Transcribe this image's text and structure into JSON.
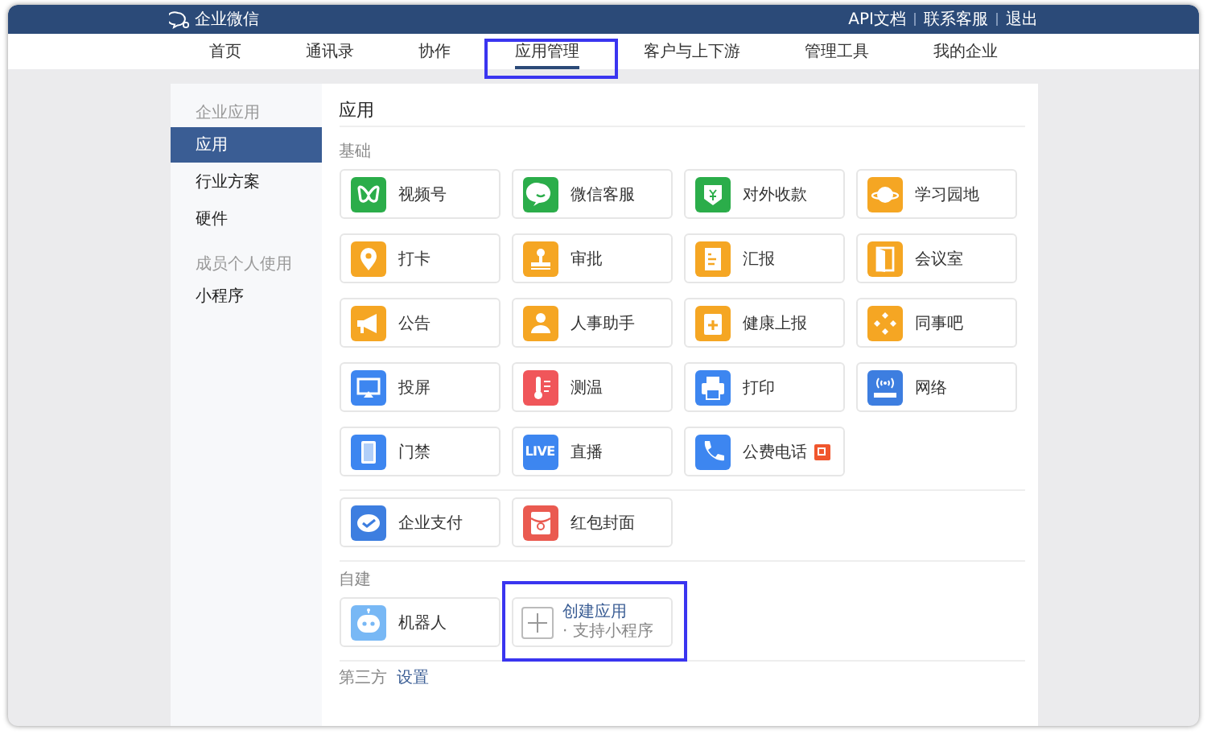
{
  "topbar": {
    "brand": "企业微信",
    "links": [
      "API文档",
      "联系客服",
      "退出"
    ]
  },
  "nav": [
    {
      "label": "首页",
      "selected": false,
      "highlighted": false
    },
    {
      "label": "通讯录",
      "selected": false,
      "highlighted": false
    },
    {
      "label": "协作",
      "selected": false,
      "highlighted": false
    },
    {
      "label": "应用管理",
      "selected": true,
      "highlighted": true
    },
    {
      "label": "客户与上下游",
      "selected": false,
      "highlighted": false
    },
    {
      "label": "管理工具",
      "selected": false,
      "highlighted": false
    },
    {
      "label": "我的企业",
      "selected": false,
      "highlighted": false
    }
  ],
  "sidebar": {
    "groups": [
      {
        "label": "企业应用",
        "items": [
          {
            "label": "应用",
            "selected": true
          },
          {
            "label": "行业方案",
            "selected": false
          },
          {
            "label": "硬件",
            "selected": false
          }
        ]
      },
      {
        "label": "成员个人使用",
        "items": [
          {
            "label": "小程序",
            "selected": false
          }
        ]
      }
    ]
  },
  "main": {
    "title": "应用",
    "sections": [
      {
        "label": "基础",
        "apps": [
          {
            "name": "视频号",
            "color": "#2bad4a"
          },
          {
            "name": "微信客服",
            "color": "#2bad4a"
          },
          {
            "name": "对外收款",
            "color": "#2bad4a"
          },
          {
            "name": "学习园地",
            "color": "#f5a623"
          },
          {
            "name": "打卡",
            "color": "#f5a623"
          },
          {
            "name": "审批",
            "color": "#f5a623"
          },
          {
            "name": "汇报",
            "color": "#f5a623"
          },
          {
            "name": "会议室",
            "color": "#f5a623"
          },
          {
            "name": "公告",
            "color": "#f5a623"
          },
          {
            "name": "人事助手",
            "color": "#f5a623"
          },
          {
            "name": "健康上报",
            "color": "#f5a623"
          },
          {
            "name": "同事吧",
            "color": "#f5a623"
          },
          {
            "name": "投屏",
            "color": "#3d86f0"
          },
          {
            "name": "测温",
            "color": "#f0565a"
          },
          {
            "name": "打印",
            "color": "#3d86f0"
          },
          {
            "name": "网络",
            "color": "#3d7ee0"
          },
          {
            "name": "门禁",
            "color": "#3d86f0"
          },
          {
            "name": "直播",
            "color": "#3d86f0",
            "icon_text": "LIVE"
          },
          {
            "name": "公费电话",
            "color": "#3d86f0",
            "badge": true
          }
        ]
      },
      {
        "apps": [
          {
            "name": "企业支付",
            "color": "#3d7ee0"
          },
          {
            "name": "红包封面",
            "color": "#ea5a50"
          }
        ]
      },
      {
        "label": "自建",
        "apps": [
          {
            "name": "机器人",
            "color": "#78b8f5"
          }
        ],
        "create": {
          "label": "创建应用",
          "hint": "· 支持小程序",
          "highlighted": true
        }
      }
    ],
    "footer": {
      "label": "第三方",
      "link": "设置"
    }
  }
}
